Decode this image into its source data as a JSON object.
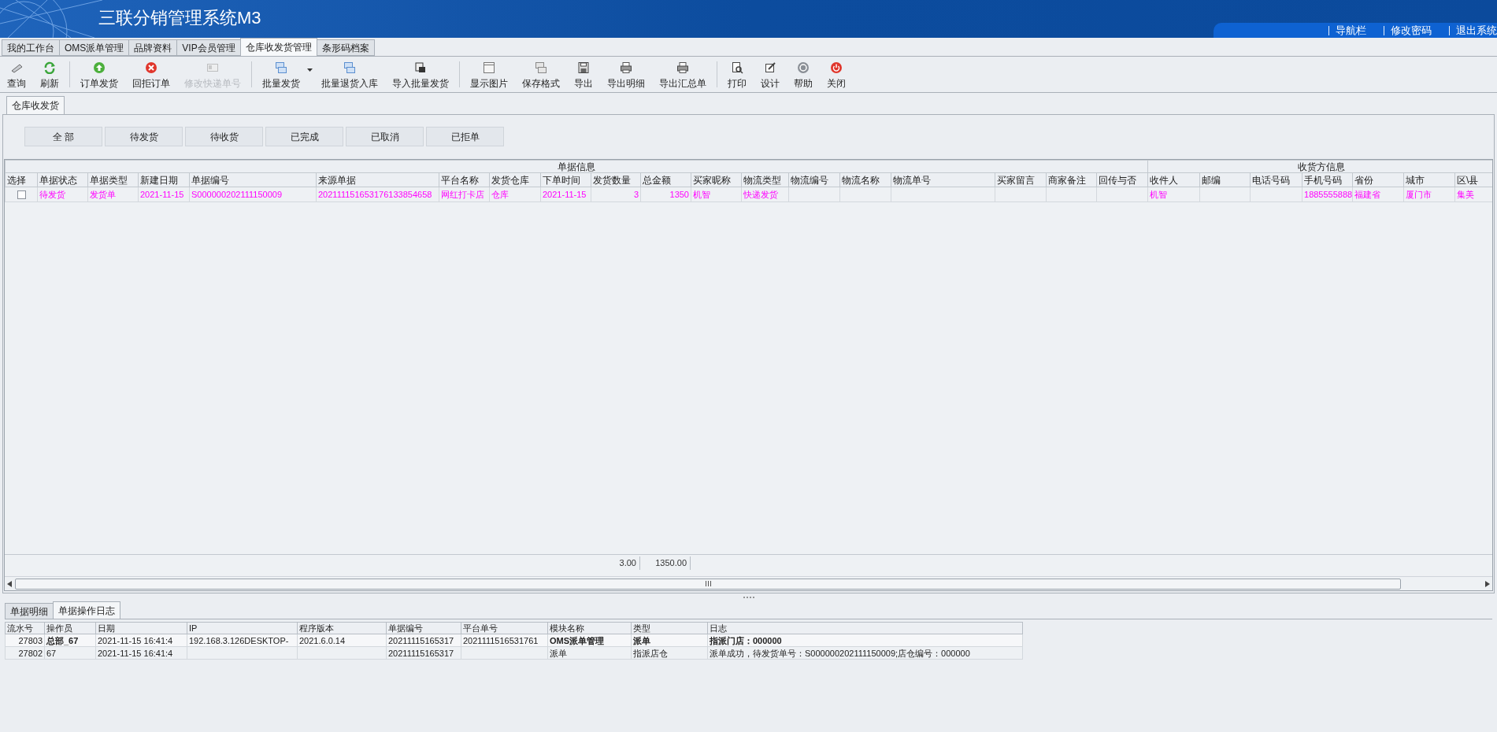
{
  "header": {
    "title": "三联分销管理系统M3",
    "links": [
      "导航栏",
      "修改密码",
      "退出系统"
    ]
  },
  "main_tabs": [
    {
      "label": "我的工作台",
      "selected": false
    },
    {
      "label": "OMS派单管理",
      "selected": false
    },
    {
      "label": "品牌资料",
      "selected": false
    },
    {
      "label": "VIP会员管理",
      "selected": false
    },
    {
      "label": "仓库收发货管理",
      "selected": true
    },
    {
      "label": "条形码档案",
      "selected": false
    }
  ],
  "toolbar": [
    {
      "items": [
        {
          "label": "查询",
          "disabled": false,
          "dropdown": false
        },
        {
          "label": "刷新",
          "disabled": false,
          "dropdown": false
        }
      ]
    },
    {
      "items": [
        {
          "label": "订单发货",
          "disabled": false,
          "dropdown": false
        },
        {
          "label": "回拒订单",
          "disabled": false,
          "dropdown": false
        },
        {
          "label": "修改快递单号",
          "disabled": true,
          "dropdown": false
        }
      ]
    },
    {
      "items": [
        {
          "label": "批量发货",
          "disabled": false,
          "dropdown": true
        },
        {
          "label": "批量退货入库",
          "disabled": false,
          "dropdown": false
        },
        {
          "label": "导入批量发货",
          "disabled": false,
          "dropdown": false
        }
      ]
    },
    {
      "items": [
        {
          "label": "显示图片",
          "disabled": false,
          "dropdown": false
        },
        {
          "label": "保存格式",
          "disabled": false,
          "dropdown": false
        },
        {
          "label": "导出",
          "disabled": false,
          "dropdown": false
        },
        {
          "label": "导出明细",
          "disabled": false,
          "dropdown": false
        },
        {
          "label": "导出汇总单",
          "disabled": false,
          "dropdown": false
        }
      ]
    },
    {
      "items": [
        {
          "label": "打印",
          "disabled": false,
          "dropdown": false
        },
        {
          "label": "设计",
          "disabled": false,
          "dropdown": false
        },
        {
          "label": "帮助",
          "disabled": false,
          "dropdown": false
        },
        {
          "label": "关闭",
          "disabled": false,
          "dropdown": false
        }
      ]
    }
  ],
  "sub_tab": {
    "label": "仓库收发货",
    "selected": true
  },
  "filters": [
    "全 部",
    "待发货",
    "待收货",
    "已完成",
    "已取消",
    "已拒单"
  ],
  "table": {
    "column_groups": [
      {
        "label": "单据信息",
        "columns": [
          "选择",
          "单据状态",
          "单据类型",
          "新建日期",
          "单据编号",
          "来源单据",
          "平台名称",
          "发货仓库",
          "下单时间",
          "发货数量",
          "总金额",
          "买家昵称",
          "物流类型",
          "物流编号",
          "物流名称",
          "物流单号",
          "买家留言",
          "商家备注",
          "回传与否"
        ]
      },
      {
        "label": "收货方信息",
        "columns": [
          "收件人",
          "邮编",
          "电话号码",
          "手机号码",
          "省份",
          "城市",
          "区\\县"
        ]
      }
    ],
    "rows": [
      {
        "checked": false,
        "cells": [
          "待发货",
          "发货单",
          "2021-11-15",
          "S000000202111150009",
          "202111151653176133854658",
          "网红打卡店",
          "仓库",
          "2021-11-15",
          "3",
          "1350",
          "机智",
          "快递发货",
          null,
          null,
          null,
          null,
          null,
          null,
          "机智",
          null,
          null,
          "1885555888",
          "福建省",
          "厦门市",
          "集美"
        ]
      }
    ],
    "summary": [
      "3.00",
      "1350.00"
    ]
  },
  "bottom_tabs": [
    {
      "label": "单据明细",
      "selected": false
    },
    {
      "label": "单据操作日志",
      "selected": true
    }
  ],
  "log": {
    "columns": [
      "流水号",
      "操作员",
      "日期",
      "IP",
      "程序版本",
      "单据编号",
      "平台单号",
      "模块名称",
      "类型",
      "日志"
    ],
    "rows": [
      {
        "selected": true,
        "cells": [
          "27803",
          "总部_67",
          "2021-11-15 16:41:4",
          "192.168.3.126DESKTOP-",
          "2021.6.0.14",
          "20211115165317",
          "2021111516531761",
          "OMS派单管理",
          "派单",
          "指派门店：000000"
        ]
      },
      {
        "selected": false,
        "cells": [
          "27802",
          "67",
          "2021-11-15 16:41:4",
          null,
          null,
          "20211115165317",
          null,
          "派单",
          "指派店仓",
          "派单成功，待发货单号：S000000202111150009;店仓编号：000000"
        ]
      }
    ]
  }
}
